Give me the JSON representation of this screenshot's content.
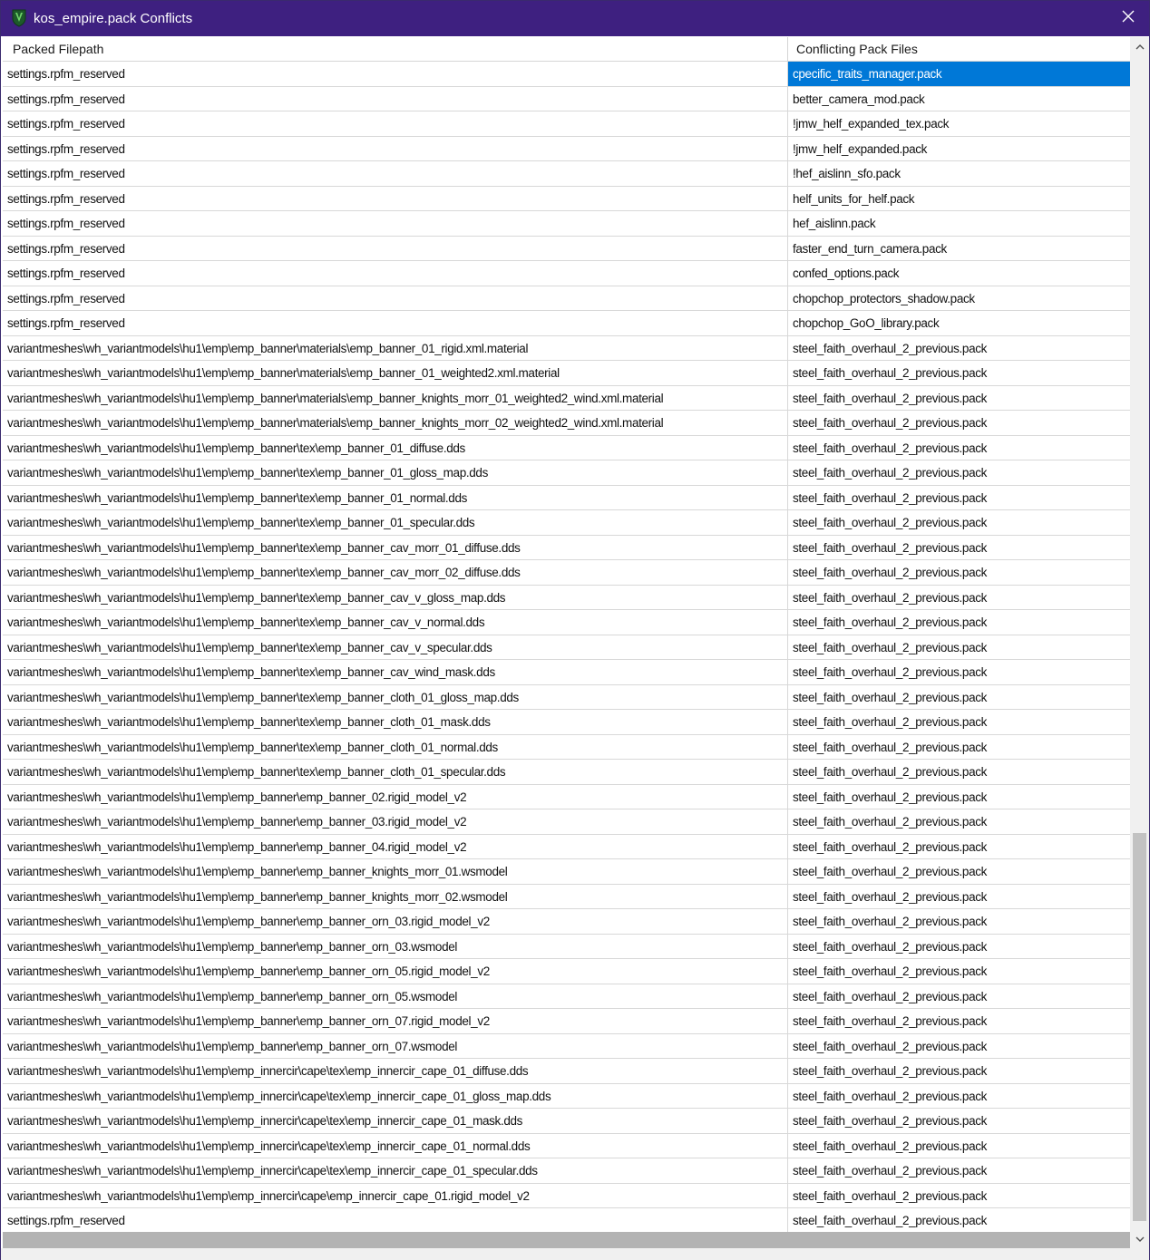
{
  "window": {
    "title": "kos_empire.pack Conflicts",
    "app_icon": "v-shield-icon",
    "close_icon": "close-icon",
    "titlebar_color": "#3e2080",
    "selection_color": "#0078d7"
  },
  "table": {
    "columns": [
      "Packed Filepath",
      "Conflicting Pack Files"
    ],
    "selected_row": 0,
    "rows": [
      {
        "path": "settings.rpfm_reserved",
        "pack": "cpecific_traits_manager.pack"
      },
      {
        "path": "settings.rpfm_reserved",
        "pack": "better_camera_mod.pack"
      },
      {
        "path": "settings.rpfm_reserved",
        "pack": "!jmw_helf_expanded_tex.pack"
      },
      {
        "path": "settings.rpfm_reserved",
        "pack": "!jmw_helf_expanded.pack"
      },
      {
        "path": "settings.rpfm_reserved",
        "pack": "!hef_aislinn_sfo.pack"
      },
      {
        "path": "settings.rpfm_reserved",
        "pack": "helf_units_for_helf.pack"
      },
      {
        "path": "settings.rpfm_reserved",
        "pack": "hef_aislinn.pack"
      },
      {
        "path": "settings.rpfm_reserved",
        "pack": "faster_end_turn_camera.pack"
      },
      {
        "path": "settings.rpfm_reserved",
        "pack": "confed_options.pack"
      },
      {
        "path": "settings.rpfm_reserved",
        "pack": "chopchop_protectors_shadow.pack"
      },
      {
        "path": "settings.rpfm_reserved",
        "pack": "chopchop_GoO_library.pack"
      },
      {
        "path": "variantmeshes\\wh_variantmodels\\hu1\\emp\\emp_banner\\materials\\emp_banner_01_rigid.xml.material",
        "pack": "steel_faith_overhaul_2_previous.pack"
      },
      {
        "path": "variantmeshes\\wh_variantmodels\\hu1\\emp\\emp_banner\\materials\\emp_banner_01_weighted2.xml.material",
        "pack": "steel_faith_overhaul_2_previous.pack"
      },
      {
        "path": "variantmeshes\\wh_variantmodels\\hu1\\emp\\emp_banner\\materials\\emp_banner_knights_morr_01_weighted2_wind.xml.material",
        "pack": "steel_faith_overhaul_2_previous.pack"
      },
      {
        "path": "variantmeshes\\wh_variantmodels\\hu1\\emp\\emp_banner\\materials\\emp_banner_knights_morr_02_weighted2_wind.xml.material",
        "pack": "steel_faith_overhaul_2_previous.pack"
      },
      {
        "path": "variantmeshes\\wh_variantmodels\\hu1\\emp\\emp_banner\\tex\\emp_banner_01_diffuse.dds",
        "pack": "steel_faith_overhaul_2_previous.pack"
      },
      {
        "path": "variantmeshes\\wh_variantmodels\\hu1\\emp\\emp_banner\\tex\\emp_banner_01_gloss_map.dds",
        "pack": "steel_faith_overhaul_2_previous.pack"
      },
      {
        "path": "variantmeshes\\wh_variantmodels\\hu1\\emp\\emp_banner\\tex\\emp_banner_01_normal.dds",
        "pack": "steel_faith_overhaul_2_previous.pack"
      },
      {
        "path": "variantmeshes\\wh_variantmodels\\hu1\\emp\\emp_banner\\tex\\emp_banner_01_specular.dds",
        "pack": "steel_faith_overhaul_2_previous.pack"
      },
      {
        "path": "variantmeshes\\wh_variantmodels\\hu1\\emp\\emp_banner\\tex\\emp_banner_cav_morr_01_diffuse.dds",
        "pack": "steel_faith_overhaul_2_previous.pack"
      },
      {
        "path": "variantmeshes\\wh_variantmodels\\hu1\\emp\\emp_banner\\tex\\emp_banner_cav_morr_02_diffuse.dds",
        "pack": "steel_faith_overhaul_2_previous.pack"
      },
      {
        "path": "variantmeshes\\wh_variantmodels\\hu1\\emp\\emp_banner\\tex\\emp_banner_cav_v_gloss_map.dds",
        "pack": "steel_faith_overhaul_2_previous.pack"
      },
      {
        "path": "variantmeshes\\wh_variantmodels\\hu1\\emp\\emp_banner\\tex\\emp_banner_cav_v_normal.dds",
        "pack": "steel_faith_overhaul_2_previous.pack"
      },
      {
        "path": "variantmeshes\\wh_variantmodels\\hu1\\emp\\emp_banner\\tex\\emp_banner_cav_v_specular.dds",
        "pack": "steel_faith_overhaul_2_previous.pack"
      },
      {
        "path": "variantmeshes\\wh_variantmodels\\hu1\\emp\\emp_banner\\tex\\emp_banner_cav_wind_mask.dds",
        "pack": "steel_faith_overhaul_2_previous.pack"
      },
      {
        "path": "variantmeshes\\wh_variantmodels\\hu1\\emp\\emp_banner\\tex\\emp_banner_cloth_01_gloss_map.dds",
        "pack": "steel_faith_overhaul_2_previous.pack"
      },
      {
        "path": "variantmeshes\\wh_variantmodels\\hu1\\emp\\emp_banner\\tex\\emp_banner_cloth_01_mask.dds",
        "pack": "steel_faith_overhaul_2_previous.pack"
      },
      {
        "path": "variantmeshes\\wh_variantmodels\\hu1\\emp\\emp_banner\\tex\\emp_banner_cloth_01_normal.dds",
        "pack": "steel_faith_overhaul_2_previous.pack"
      },
      {
        "path": "variantmeshes\\wh_variantmodels\\hu1\\emp\\emp_banner\\tex\\emp_banner_cloth_01_specular.dds",
        "pack": "steel_faith_overhaul_2_previous.pack"
      },
      {
        "path": "variantmeshes\\wh_variantmodels\\hu1\\emp\\emp_banner\\emp_banner_02.rigid_model_v2",
        "pack": "steel_faith_overhaul_2_previous.pack"
      },
      {
        "path": "variantmeshes\\wh_variantmodels\\hu1\\emp\\emp_banner\\emp_banner_03.rigid_model_v2",
        "pack": "steel_faith_overhaul_2_previous.pack"
      },
      {
        "path": "variantmeshes\\wh_variantmodels\\hu1\\emp\\emp_banner\\emp_banner_04.rigid_model_v2",
        "pack": "steel_faith_overhaul_2_previous.pack"
      },
      {
        "path": "variantmeshes\\wh_variantmodels\\hu1\\emp\\emp_banner\\emp_banner_knights_morr_01.wsmodel",
        "pack": "steel_faith_overhaul_2_previous.pack"
      },
      {
        "path": "variantmeshes\\wh_variantmodels\\hu1\\emp\\emp_banner\\emp_banner_knights_morr_02.wsmodel",
        "pack": "steel_faith_overhaul_2_previous.pack"
      },
      {
        "path": "variantmeshes\\wh_variantmodels\\hu1\\emp\\emp_banner\\emp_banner_orn_03.rigid_model_v2",
        "pack": "steel_faith_overhaul_2_previous.pack"
      },
      {
        "path": "variantmeshes\\wh_variantmodels\\hu1\\emp\\emp_banner\\emp_banner_orn_03.wsmodel",
        "pack": "steel_faith_overhaul_2_previous.pack"
      },
      {
        "path": "variantmeshes\\wh_variantmodels\\hu1\\emp\\emp_banner\\emp_banner_orn_05.rigid_model_v2",
        "pack": "steel_faith_overhaul_2_previous.pack"
      },
      {
        "path": "variantmeshes\\wh_variantmodels\\hu1\\emp\\emp_banner\\emp_banner_orn_05.wsmodel",
        "pack": "steel_faith_overhaul_2_previous.pack"
      },
      {
        "path": "variantmeshes\\wh_variantmodels\\hu1\\emp\\emp_banner\\emp_banner_orn_07.rigid_model_v2",
        "pack": "steel_faith_overhaul_2_previous.pack"
      },
      {
        "path": "variantmeshes\\wh_variantmodels\\hu1\\emp\\emp_banner\\emp_banner_orn_07.wsmodel",
        "pack": "steel_faith_overhaul_2_previous.pack"
      },
      {
        "path": "variantmeshes\\wh_variantmodels\\hu1\\emp\\emp_innercir\\cape\\tex\\emp_innercir_cape_01_diffuse.dds",
        "pack": "steel_faith_overhaul_2_previous.pack"
      },
      {
        "path": "variantmeshes\\wh_variantmodels\\hu1\\emp\\emp_innercir\\cape\\tex\\emp_innercir_cape_01_gloss_map.dds",
        "pack": "steel_faith_overhaul_2_previous.pack"
      },
      {
        "path": "variantmeshes\\wh_variantmodels\\hu1\\emp\\emp_innercir\\cape\\tex\\emp_innercir_cape_01_mask.dds",
        "pack": "steel_faith_overhaul_2_previous.pack"
      },
      {
        "path": "variantmeshes\\wh_variantmodels\\hu1\\emp\\emp_innercir\\cape\\tex\\emp_innercir_cape_01_normal.dds",
        "pack": "steel_faith_overhaul_2_previous.pack"
      },
      {
        "path": "variantmeshes\\wh_variantmodels\\hu1\\emp\\emp_innercir\\cape\\tex\\emp_innercir_cape_01_specular.dds",
        "pack": "steel_faith_overhaul_2_previous.pack"
      },
      {
        "path": "variantmeshes\\wh_variantmodels\\hu1\\emp\\emp_innercir\\cape\\emp_innercir_cape_01.rigid_model_v2",
        "pack": "steel_faith_overhaul_2_previous.pack"
      },
      {
        "path": "settings.rpfm_reserved",
        "pack": "steel_faith_overhaul_2_previous.pack"
      }
    ]
  },
  "scrollbar": {
    "up_icon": "chevron-up-icon",
    "down_icon": "chevron-down-icon"
  }
}
